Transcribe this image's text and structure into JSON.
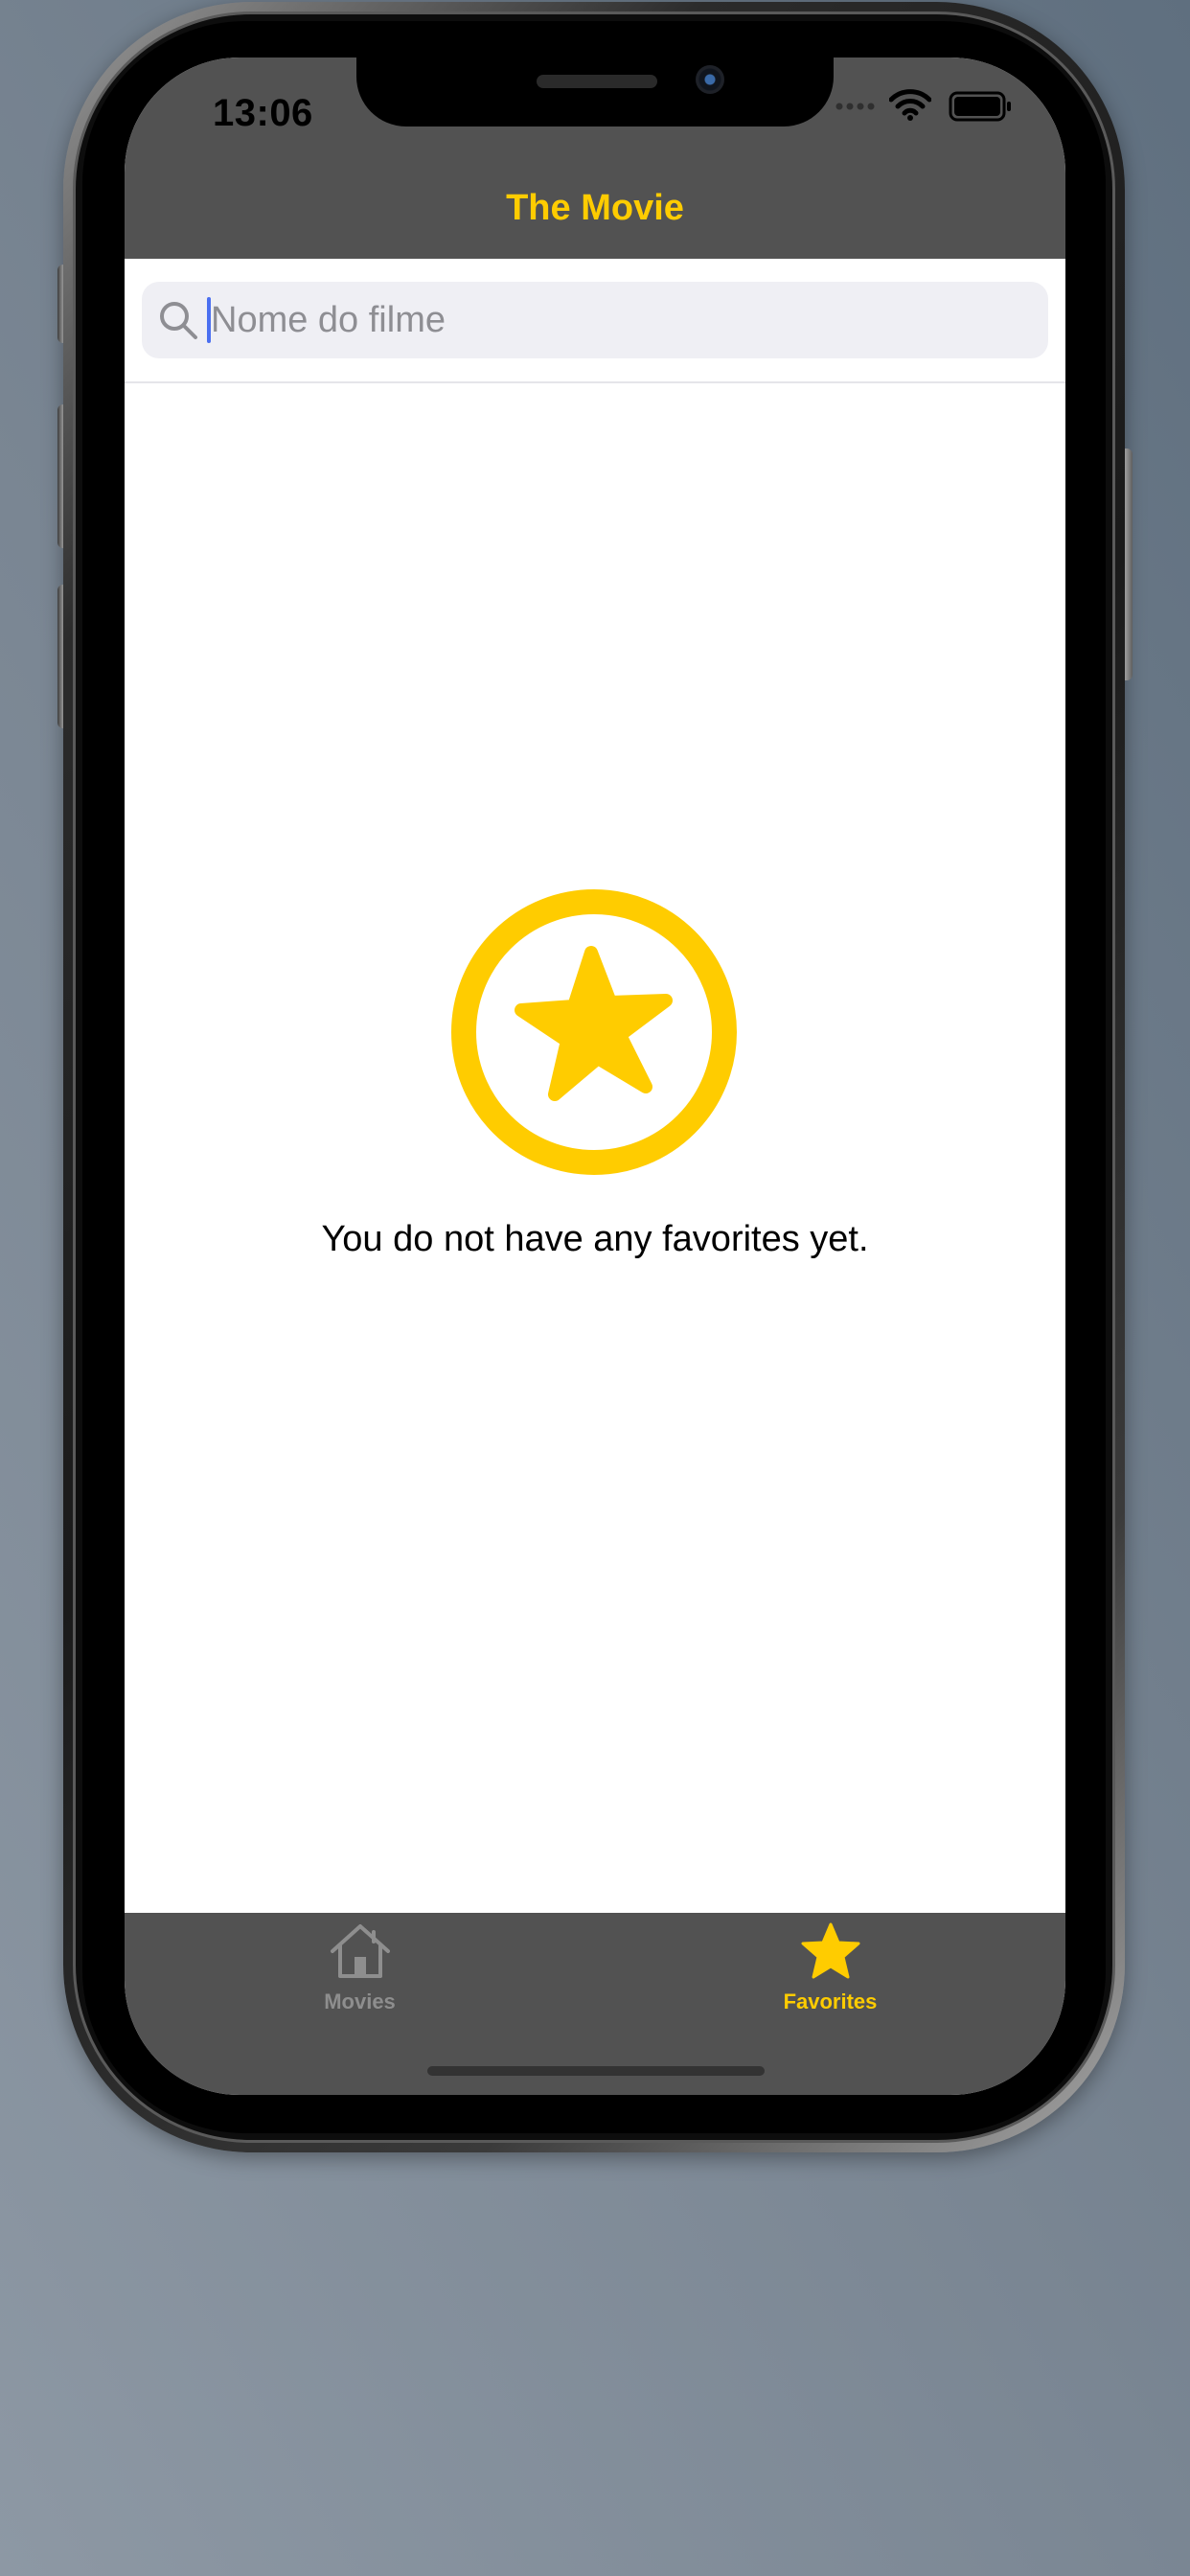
{
  "status_bar": {
    "time": "13:06"
  },
  "nav": {
    "title": "The Movie"
  },
  "search": {
    "placeholder": "Nome do filme",
    "value": ""
  },
  "empty_state": {
    "icon": "star-circle-icon",
    "message": "You do not have any favorites yet."
  },
  "tab_bar": {
    "tabs": [
      {
        "label": "Movies",
        "icon": "house-icon",
        "selected": false
      },
      {
        "label": "Favorites",
        "icon": "star-icon",
        "selected": true
      }
    ]
  },
  "colors": {
    "accent": "#ffcc00",
    "bar_background": "#525252",
    "inactive_tab": "#8e8e8e",
    "search_background": "#efeff4",
    "caret": "#4b6ff0"
  }
}
